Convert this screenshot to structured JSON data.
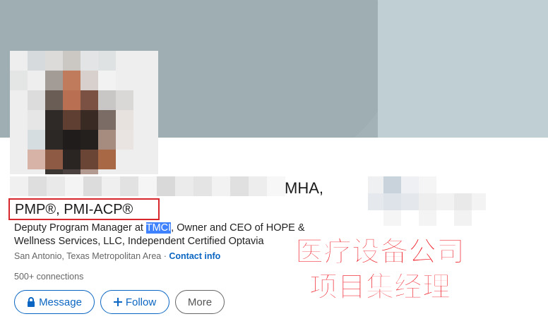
{
  "profile": {
    "name_suffix": "MHA,",
    "credentials": "PMP®, PMI-ACP®",
    "headline_before": "Deputy Program Manager at ",
    "headline_highlight": "TMCI",
    "headline_after": ", Owner and CEO of HOPE & Wellness Services, LLC, Independent Certified Optavia",
    "location": "San Antonio, Texas Metropolitan Area",
    "separator": " · ",
    "contact_link": "Contact info",
    "connections": "500+ connections"
  },
  "actions": {
    "message_label": "Message",
    "follow_label": "Follow",
    "more_label": "More"
  },
  "overlay": {
    "line1": "医疗设备公司",
    "line2": "项目集经理"
  },
  "colors": {
    "brand_blue": "#0a66c2",
    "overlay_red": "#ef1f2a",
    "highlight_box_red": "#d8262d"
  },
  "icons": {
    "message": "lock-icon",
    "follow": "plus-icon"
  }
}
